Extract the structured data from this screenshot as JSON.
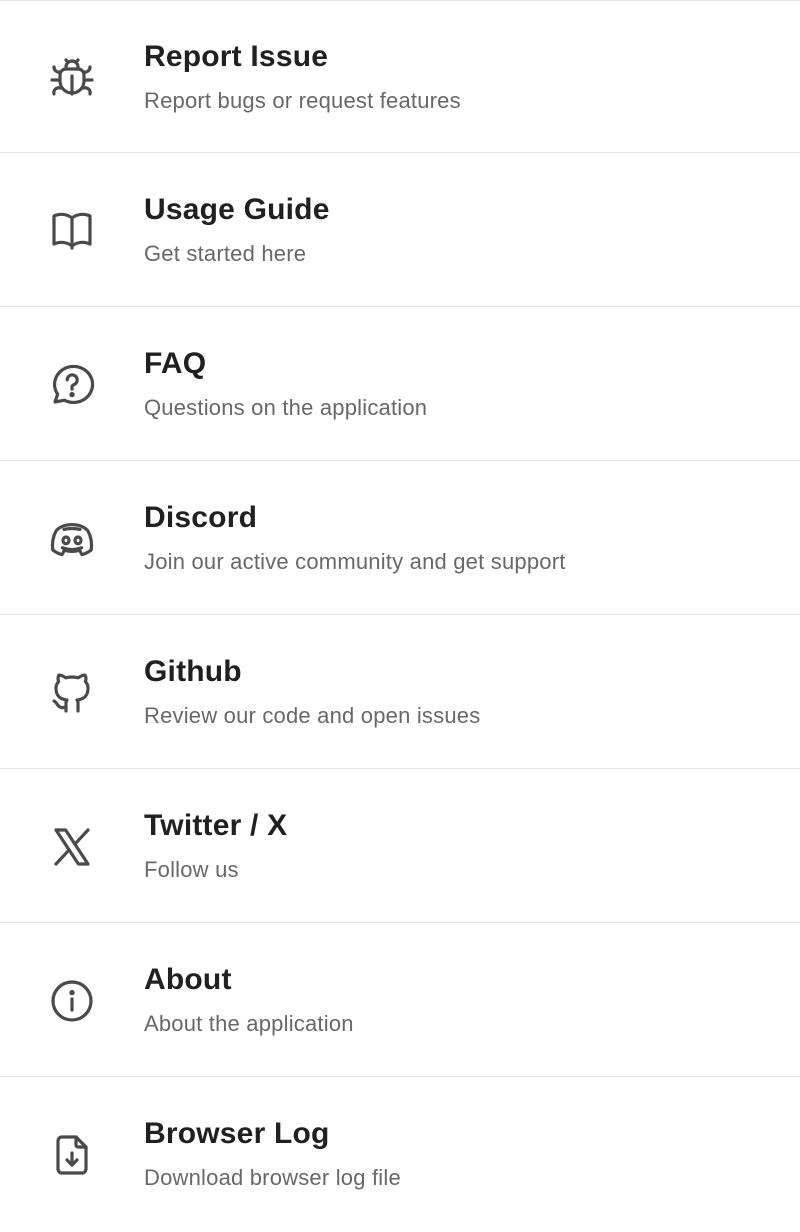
{
  "menu": {
    "items": [
      {
        "title": "Report Issue",
        "subtitle": "Report bugs or request features",
        "icon": "bug-icon"
      },
      {
        "title": "Usage Guide",
        "subtitle": "Get started here",
        "icon": "book-icon"
      },
      {
        "title": "FAQ",
        "subtitle": "Questions on the application",
        "icon": "question-bubble-icon"
      },
      {
        "title": "Discord",
        "subtitle": "Join our active community and get support",
        "icon": "discord-icon"
      },
      {
        "title": "Github",
        "subtitle": "Review our code and open issues",
        "icon": "github-icon"
      },
      {
        "title": "Twitter / X",
        "subtitle": "Follow us",
        "icon": "x-logo-icon"
      },
      {
        "title": "About",
        "subtitle": "About the application",
        "icon": "info-icon"
      },
      {
        "title": "Browser Log",
        "subtitle": "Download browser log file",
        "icon": "file-download-icon"
      }
    ]
  },
  "colors": {
    "title": "#202020",
    "subtitle": "#686868",
    "icon": "#4a4a4a",
    "divider": "#e3e3e3",
    "background": "#ffffff"
  }
}
